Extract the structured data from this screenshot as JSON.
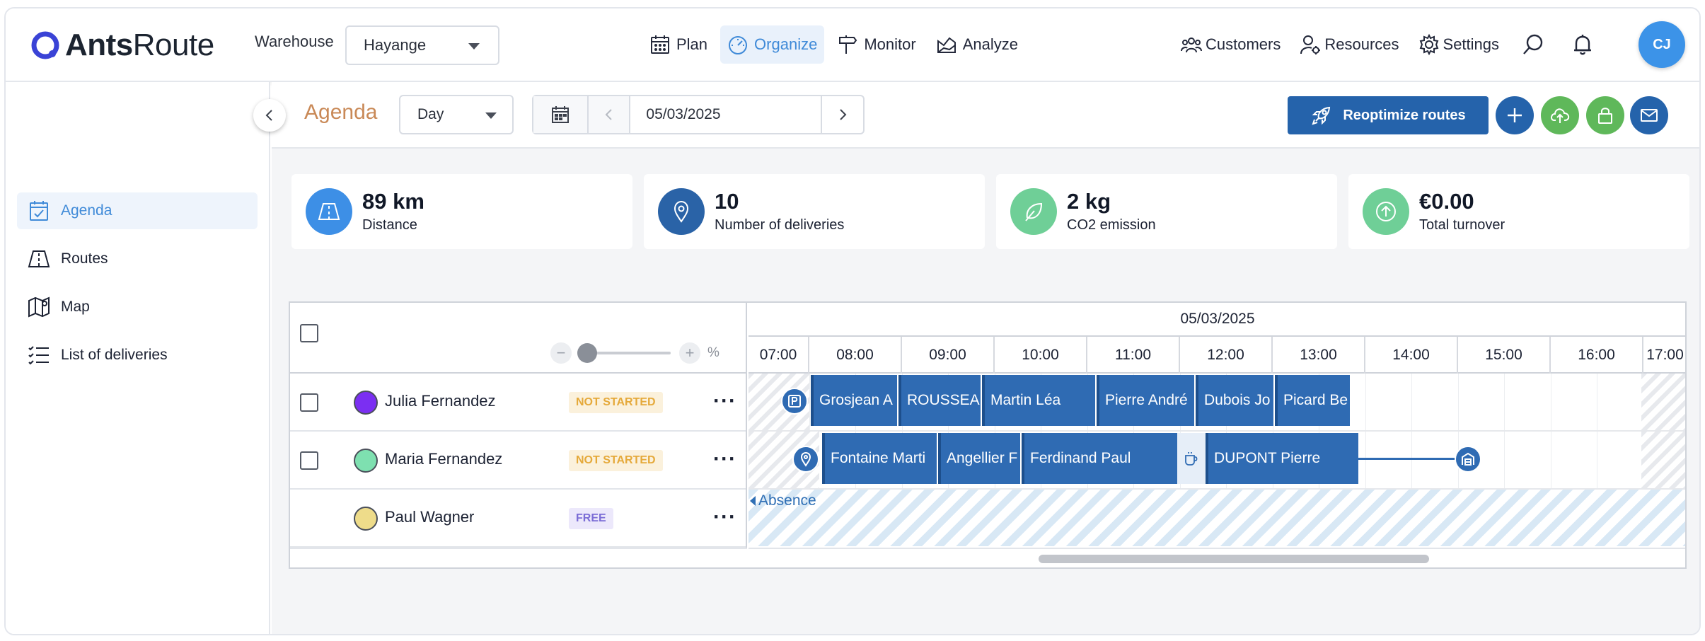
{
  "header": {
    "logo_ants": "Ants",
    "logo_route": "Route",
    "warehouse_label": "Warehouse",
    "warehouse_value": "Hayange",
    "nav": [
      {
        "label": "Plan",
        "icon": "calendar-icon"
      },
      {
        "label": "Organize",
        "icon": "gauge-icon",
        "active": true
      },
      {
        "label": "Monitor",
        "icon": "signpost-icon"
      },
      {
        "label": "Analyze",
        "icon": "chart-icon"
      }
    ],
    "right_nav": [
      {
        "label": "Customers",
        "icon": "customers-icon"
      },
      {
        "label": "Resources",
        "icon": "resources-icon"
      },
      {
        "label": "Settings",
        "icon": "gear-icon"
      }
    ],
    "avatar_initials": "CJ",
    "accent_color": "#3f8ad8"
  },
  "sidebar": {
    "items": [
      {
        "label": "Agenda",
        "icon": "agenda-icon",
        "active": true
      },
      {
        "label": "Routes",
        "icon": "routes-icon"
      },
      {
        "label": "Map",
        "icon": "map-icon"
      },
      {
        "label": "List of deliveries",
        "icon": "list-icon"
      }
    ]
  },
  "toolbar": {
    "title": "Agenda",
    "view_value": "Day",
    "date_value": "05/03/2025",
    "reoptimize_label": "Reoptimize routes",
    "primary_color": "#2563ab"
  },
  "kpis": [
    {
      "value": "89 km",
      "label": "Distance",
      "icon": "distance-icon",
      "color": "#3d8fe6"
    },
    {
      "value": "10",
      "label": "Number of deliveries",
      "icon": "location-pin-icon",
      "color": "#2a63a7"
    },
    {
      "value": "2 kg",
      "label": "CO2 emission",
      "icon": "leaf-icon",
      "color": "#6fcf97"
    },
    {
      "value": "€0.00",
      "label": "Total turnover",
      "icon": "arrow-up-icon",
      "color": "#6fcf97"
    }
  ],
  "gantt": {
    "date": "05/03/2025",
    "zoom_unit": "%",
    "zoom_fraction": 0.0,
    "hours": [
      "07:00",
      "08:00",
      "09:00",
      "10:00",
      "11:00",
      "12:00",
      "13:00",
      "14:00",
      "15:00",
      "16:00",
      "17:00"
    ],
    "resources": [
      {
        "name": "Julia Fernandez",
        "status": "NOT STARTED",
        "color": "#7b2ff2"
      },
      {
        "name": "Maria Fernandez",
        "status": "NOT STARTED",
        "color": "#7ee0b0"
      },
      {
        "name": "Paul Wagner",
        "status": "FREE",
        "color": "#eedc8a"
      }
    ],
    "row1_tasks": [
      "Grosjean A",
      "ROUSSEAU",
      "Martin Léa",
      "Pierre André",
      "Dubois Jo",
      "Picard Be"
    ],
    "row2_tasks": [
      "Fontaine Marti",
      "Angellier F",
      "Ferdinand Paul",
      "DUPONT Pierre"
    ],
    "absence_label": "Absence",
    "task_color": "#2f6bb3"
  }
}
